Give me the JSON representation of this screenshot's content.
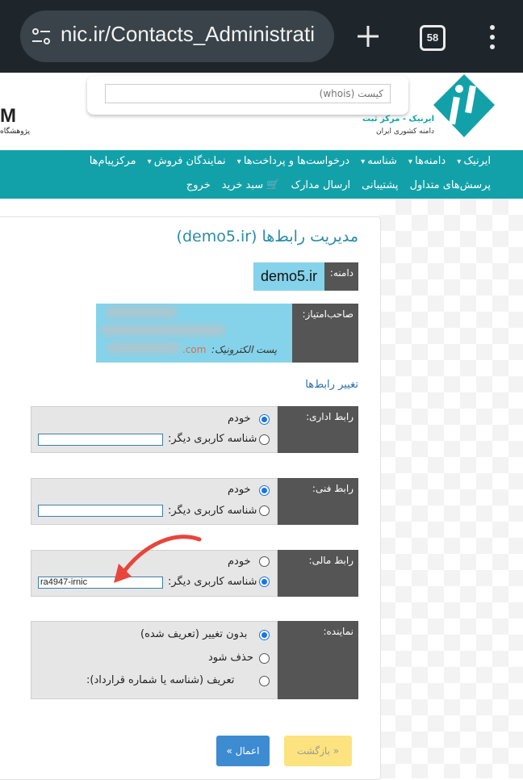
{
  "browser": {
    "url": "nic.ir/Contacts_Administrati",
    "tab_count": "58"
  },
  "header": {
    "search_placeholder": "کیست (whois)",
    "logo_line1": "ایرنیک - مرکز ثبت",
    "logo_line2": "دامنه کشوری ایران",
    "edge_logo": "M",
    "edge_text": "پژوهشگاه"
  },
  "nav": {
    "row1": [
      "ایرنیک",
      "دامنه‌ها",
      "شناسه",
      "درخواست‌ها و پرداخت‌ها",
      "نمایندگان فروش",
      "مرکزپیام‌ها"
    ],
    "row2": [
      "پرسش‌های متداول",
      "پشتیبانی",
      "ارسال مدارک",
      "سبد خرید",
      "خروج"
    ]
  },
  "page": {
    "title": "مدیریت رابط‌ها (demo5.ir)",
    "domain_label": "دامنه:",
    "domain_value": "demo5.ir",
    "owner_label": "صاحب‌امتیاز:",
    "email_label": "پست الکترونیک:",
    "email_suffix": ".com",
    "change_contacts": "تغییر رابط‌ها"
  },
  "contacts": {
    "admin": {
      "label": "رابط اداری:",
      "self": "خودم",
      "other": "شناسه کاربری دیگر:",
      "value": "",
      "selected": "self"
    },
    "tech": {
      "label": "رابط فنی:",
      "self": "خودم",
      "other": "شناسه کاربری دیگر:",
      "value": "",
      "selected": "self"
    },
    "billing": {
      "label": "رابط مالی:",
      "self": "خودم",
      "other": "شناسه کاربری دیگر:",
      "value": "ra4947-irnic",
      "selected": "other"
    }
  },
  "reseller": {
    "label": "نماینده:",
    "opt1": "بدون تغییر (تعریف شده)",
    "opt2": "حذف شود",
    "opt3": "تعریف (شناسه یا شماره قرارداد):"
  },
  "buttons": {
    "back": "« بازگشت",
    "apply": "اعمال »"
  },
  "colors": {
    "nav": "#12a1a9",
    "highlight": "#85d3ea",
    "label_bg": "#555555",
    "annotation_arrow": "#e8453c"
  }
}
